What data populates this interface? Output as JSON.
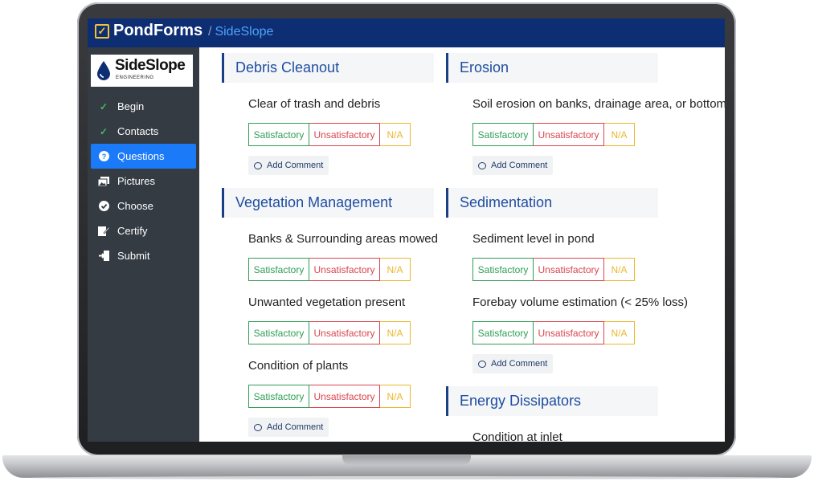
{
  "app": {
    "name": "PondForms",
    "crumb_sep": "/",
    "crumb": "SideSlope"
  },
  "logo": {
    "text": "SideSlope",
    "subtext": "ENGINEERING"
  },
  "sidebar": {
    "items": [
      {
        "label": "Begin",
        "icon": "check-icon",
        "active": false
      },
      {
        "label": "Contacts",
        "icon": "check-icon",
        "active": false
      },
      {
        "label": "Questions",
        "icon": "question-circle-icon",
        "active": true
      },
      {
        "label": "Pictures",
        "icon": "images-icon",
        "active": false
      },
      {
        "label": "Choose",
        "icon": "check-circle-icon",
        "active": false
      },
      {
        "label": "Certify",
        "icon": "signature-icon",
        "active": false
      },
      {
        "label": "Submit",
        "icon": "sign-in-icon",
        "active": false
      }
    ]
  },
  "options": {
    "satisfactory": "Satisfactory",
    "unsatisfactory": "Unsatisfactory",
    "na": "N/A"
  },
  "comment_label": "Add Comment",
  "sections": {
    "debris": {
      "title": "Debris Cleanout",
      "questions": [
        "Clear of trash and debris"
      ]
    },
    "vegetation": {
      "title": "Vegetation Management",
      "questions": [
        "Banks & Surrounding areas mowed",
        "Unwanted vegetation present",
        "Condition of plants"
      ]
    },
    "erosion": {
      "title": "Erosion",
      "questions": [
        "Soil erosion on banks, drainage area, or bottom"
      ]
    },
    "sedimentation": {
      "title": "Sedimentation",
      "questions": [
        "Sediment level in pond",
        "Forebay volume estimation (< 25% loss)"
      ]
    },
    "energy": {
      "title": "Energy Dissipators",
      "questions": [
        "Condition at inlet"
      ]
    }
  },
  "colors": {
    "topbar": "#0e2e73",
    "sidebar": "#353b43",
    "active": "#1a7af8",
    "satisfactory": "#2f9e55",
    "unsatisfactory": "#d9454f",
    "na": "#e9b82d",
    "section_title": "#1f4da0"
  }
}
